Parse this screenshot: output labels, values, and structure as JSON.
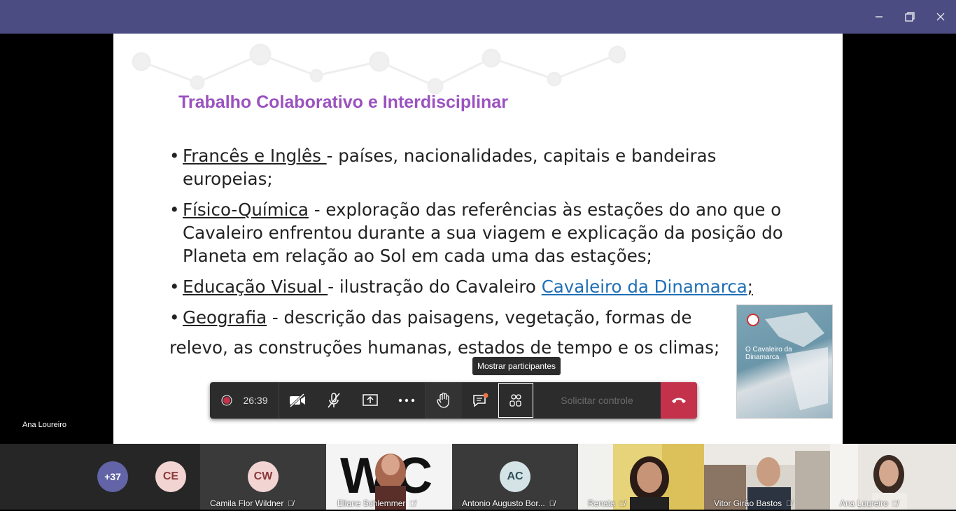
{
  "window": {
    "minimize_icon": "minimize-icon",
    "restore_icon": "restore-icon",
    "close_icon": "close-icon"
  },
  "slide": {
    "title": "Trabalho Colaborativo e Interdisciplinar",
    "bullets": [
      {
        "subject": "Francês e Inglês ",
        "text": " - países, nacionalidades, capitais e bandeiras europeias;"
      },
      {
        "subject": "Físico-Química",
        "text": " - exploração das referências às estações do ano que o Cavaleiro enfrentou durante a sua viagem e explicação da posição do Planeta em relação ao Sol em cada uma das estações;"
      },
      {
        "subject": "Educação Visual ",
        "text": "- ilustração do Cavaleiro ",
        "link": "Cavaleiro da Dinamarca",
        "tail": ";"
      },
      {
        "subject": "Geografia",
        "text": " - descrição das paisagens, vegetação, formas de",
        "text2": "relevo, as construções humanas,  estados de tempo e os climas;"
      }
    ],
    "book": {
      "title": "O Cavaleiro da Dinamarca"
    }
  },
  "presenter_name": "Ana Loureiro",
  "toolbar": {
    "timer": "26:39",
    "request_control": "Solicitar controle",
    "tooltip": "Mostrar participantes"
  },
  "participants": {
    "overflow_count": "+37",
    "tiles": [
      {
        "initials": "CE",
        "name": ""
      },
      {
        "initials": "CW",
        "name": "Camila Flor Wildner"
      },
      {
        "initials": "",
        "name": "Eliane Schlemmer"
      },
      {
        "initials": "AC",
        "name": "Antonio Augusto Bor..."
      },
      {
        "initials": "",
        "name": "Renata"
      },
      {
        "initials": "",
        "name": "Vitor Girão Bastos"
      },
      {
        "initials": "",
        "name": "Ana Loureiro"
      }
    ]
  },
  "colors": {
    "titlebar": "#4b4d82",
    "title": "#9b52c0",
    "link": "#1f6fb6",
    "hangup": "#c4314b",
    "overflow_avatar": "#6264a7"
  }
}
